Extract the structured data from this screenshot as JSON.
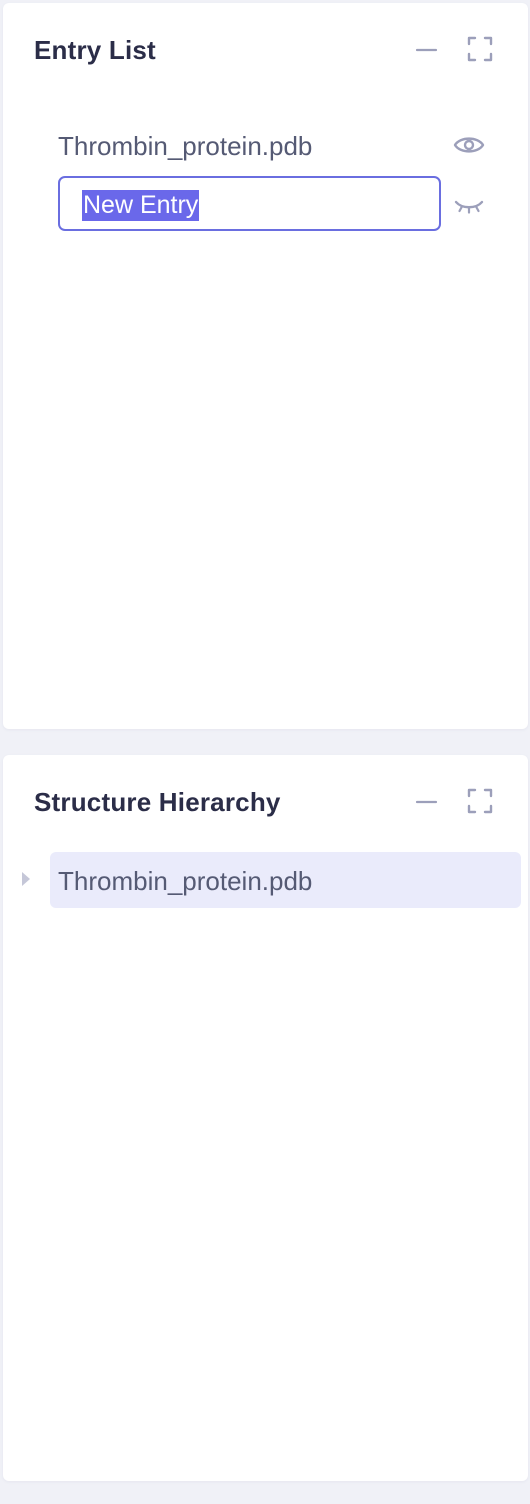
{
  "entry_list": {
    "title": "Entry List",
    "entries": [
      {
        "label": "Thrombin_protein.pdb",
        "visibility_icon": "eye-icon",
        "visible": true
      },
      {
        "label": "New Entry",
        "editing": true,
        "visibility_icon": "eye-closed-icon",
        "visible": false
      }
    ]
  },
  "structure_hierarchy": {
    "title": "Structure Hierarchy",
    "nodes": [
      {
        "label": "Thrombin_protein.pdb",
        "expanded": false,
        "selected": true
      }
    ]
  },
  "colors": {
    "accent": "#6a68ea",
    "title_text": "#2b2d48",
    "body_text": "#555a74",
    "icon": "#9c9fba",
    "selection_bg": "#eaebfb",
    "page_bg": "#f0f1f7"
  }
}
